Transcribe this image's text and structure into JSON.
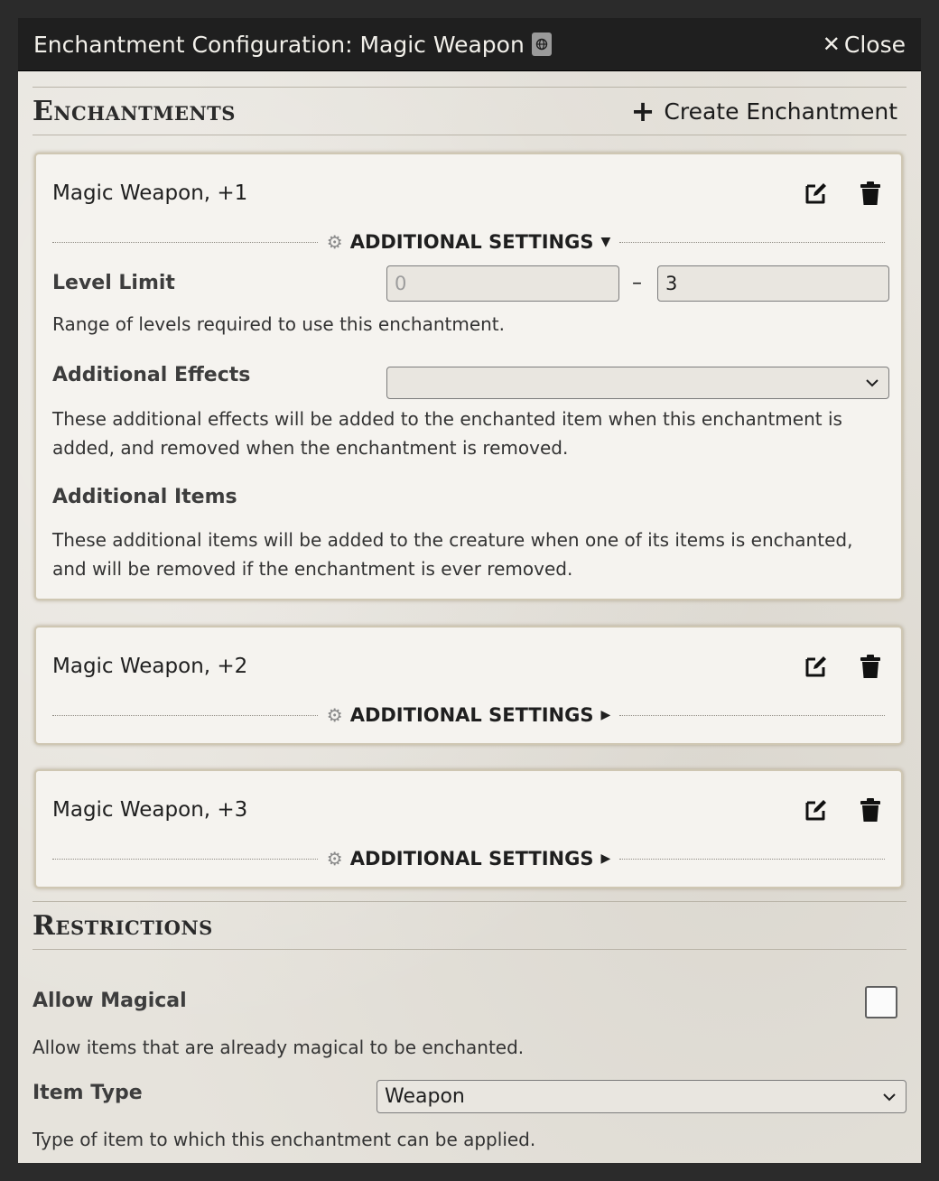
{
  "window": {
    "title": "Enchantment Configuration: Magic Weapon",
    "close_icon": "x",
    "close_label": "Close"
  },
  "enchantments_section": {
    "heading": "Enchantments",
    "create_label": "Create Enchantment"
  },
  "enchantments": [
    {
      "name": "Magic Weapon, +1",
      "settings_label": "ADDITIONAL SETTINGS",
      "expanded": true,
      "level_limit_label": "Level Limit",
      "level_min_placeholder": "0",
      "level_max_value": "3",
      "range_separator": "–",
      "level_limit_hint": "Range of levels required to use this enchantment.",
      "additional_effects_label": "Additional Effects",
      "additional_effects_value": "",
      "additional_effects_hint": "These additional effects will be added to the enchanted item when this enchantment is added, and removed when the enchantment is removed.",
      "additional_items_label": "Additional Items",
      "additional_items_hint": "These additional items will be added to the creature when one of its items is enchanted, and will be removed if the enchantment is ever removed."
    },
    {
      "name": "Magic Weapon, +2",
      "settings_label": "ADDITIONAL SETTINGS",
      "expanded": false
    },
    {
      "name": "Magic Weapon, +3",
      "settings_label": "ADDITIONAL SETTINGS",
      "expanded": false
    }
  ],
  "restrictions_section": {
    "heading": "Restrictions",
    "allow_magical_label": "Allow Magical",
    "allow_magical_checked": false,
    "allow_magical_hint": "Allow items that are already magical to be enchanted.",
    "item_type_label": "Item Type",
    "item_type_value": "Weapon",
    "item_type_hint": "Type of item to which this enchantment can be applied."
  },
  "icons": {
    "title_badge": "book-globe-icon",
    "edit": "edit-icon",
    "delete": "trash-icon",
    "settings": "gears-icon",
    "create": "plus-icon"
  }
}
